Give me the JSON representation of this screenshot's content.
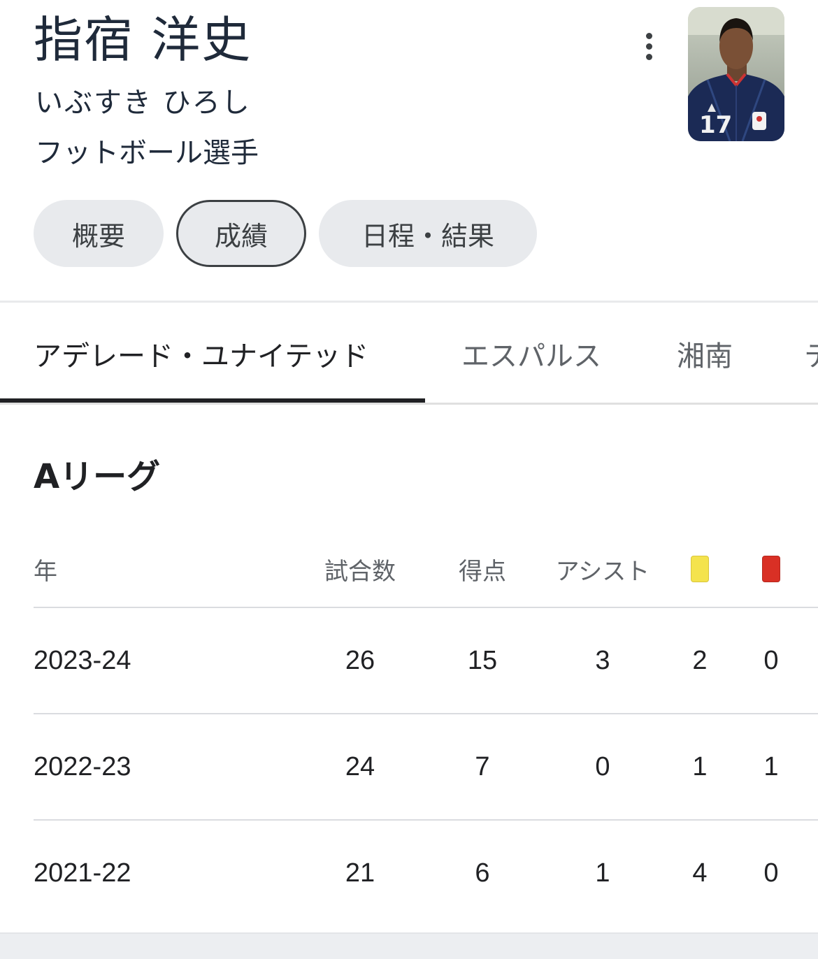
{
  "player": {
    "name": "指宿 洋史",
    "reading": "いぶすき ひろし",
    "occupation": "フットボール選手",
    "jersey_number": "17"
  },
  "chips": [
    {
      "label": "概要",
      "selected": false
    },
    {
      "label": "成績",
      "selected": true
    },
    {
      "label": "日程・結果",
      "selected": false
    }
  ],
  "team_tabs": [
    {
      "label": "アデレード・ユナイテッド",
      "active": true
    },
    {
      "label": "エスパルス",
      "active": false
    },
    {
      "label": "湘南",
      "active": false
    },
    {
      "label": "テ",
      "active": false
    }
  ],
  "league": {
    "title": "Aリーグ",
    "columns": {
      "year": "年",
      "matches": "試合数",
      "goals": "得点",
      "assists": "アシスト",
      "yellow_card": "yellow-card-icon",
      "red_card": "red-card-icon"
    },
    "rows": [
      {
        "year": "2023-24",
        "matches": "26",
        "goals": "15",
        "assists": "3",
        "yellow": "2",
        "red": "0"
      },
      {
        "year": "2022-23",
        "matches": "24",
        "goals": "7",
        "assists": "0",
        "yellow": "1",
        "red": "1"
      },
      {
        "year": "2021-22",
        "matches": "21",
        "goals": "6",
        "assists": "1",
        "yellow": "4",
        "red": "0"
      }
    ]
  },
  "colors": {
    "yellow_card": "#f4e34d",
    "red_card": "#d93025",
    "active_tab": "#202124",
    "chip_bg": "#e8eaed"
  }
}
